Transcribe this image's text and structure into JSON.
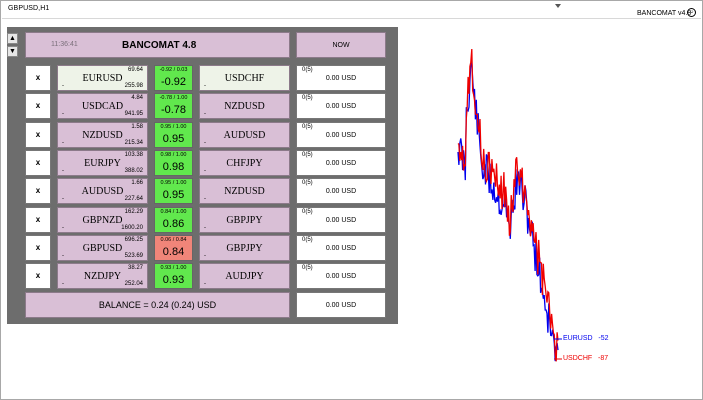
{
  "window": {
    "title": "GBPUSD,H1",
    "ea_label": "BANCOMAT v4.8",
    "smiley": "☺"
  },
  "panel": {
    "header_time": "11:36:41",
    "header_title": "BANCOMAT 4.8",
    "now_label": "NOW",
    "close_label": "x",
    "up_arrow": "▲",
    "down_arrow": "▼",
    "rows": [
      {
        "pair_a": "EURUSD",
        "a_top": "69.64",
        "a_bottom": "255.98",
        "a_dash": "-",
        "mid_small": "-0.92 / 0.03",
        "mid_big": "-0.92",
        "pair_b": "USDCHF",
        "b_dash": "-",
        "right_small": "0(5)",
        "right_val": "0.00 USD"
      },
      {
        "pair_a": "USDCAD",
        "a_top": "4.84",
        "a_bottom": "941.95",
        "a_dash": "-",
        "mid_small": "-0.78 / 1.00",
        "mid_big": "-0.78",
        "pair_b": "NZDUSD",
        "b_dash": "-",
        "right_small": "0(5)",
        "right_val": "0.00 USD"
      },
      {
        "pair_a": "NZDUSD",
        "a_top": "1.58",
        "a_bottom": "215.34",
        "a_dash": "-",
        "mid_small": "0.95 / 1.00",
        "mid_big": "0.95",
        "pair_b": "AUDUSD",
        "b_dash": "-",
        "right_small": "0(5)",
        "right_val": "0.00 USD"
      },
      {
        "pair_a": "EURJPY",
        "a_top": "103.38",
        "a_bottom": "388.02",
        "a_dash": "-",
        "mid_small": "0.98 / 1.00",
        "mid_big": "0.98",
        "pair_b": "CHFJPY",
        "b_dash": "-",
        "right_small": "0(5)",
        "right_val": "0.00 USD"
      },
      {
        "pair_a": "AUDUSD",
        "a_top": "1.66",
        "a_bottom": "227.64",
        "a_dash": "-",
        "mid_small": "0.95 / 1.00",
        "mid_big": "0.95",
        "pair_b": "NZDUSD",
        "b_dash": "-",
        "right_small": "0(5)",
        "right_val": "0.00 USD"
      },
      {
        "pair_a": "GBPNZD",
        "a_top": "162.29",
        "a_bottom": "1600.20",
        "a_dash": "-",
        "mid_small": "0.84 / 1.00",
        "mid_big": "0.86",
        "pair_b": "GBPJPY",
        "b_dash": "-",
        "right_small": "0(5)",
        "right_val": "0.00 USD"
      },
      {
        "pair_a": "GBPUSD",
        "a_top": "696.25",
        "a_bottom": "523.69",
        "a_dash": "-",
        "mid_small": "0.06 / 0.84",
        "mid_big": "0.84",
        "pair_b": "GBPJPY",
        "b_dash": "-",
        "right_small": "0(5)",
        "right_val": "0.00 USD"
      },
      {
        "pair_a": "NZDJPY",
        "a_top": "38.27",
        "a_bottom": "252.04",
        "a_dash": "-",
        "mid_small": "0.93 / 1.00",
        "mid_big": "0.93",
        "pair_b": "AUDJPY",
        "b_dash": "-",
        "right_small": "0(5)",
        "right_val": "0.00 USD"
      }
    ],
    "balance_label": "BALANCE = 0.24 (0.24)  USD",
    "balance_total": "0.00 USD"
  },
  "colors": {
    "green": "#61e84d",
    "red": "#f08579",
    "lilac": "#d9bfd6",
    "panel_bg": "#6d6d6d",
    "line_blue": "#0000ee",
    "line_red": "#ee0000"
  },
  "chart_data": {
    "type": "line",
    "series": [
      {
        "name": "EURUSD",
        "value_label": "-52",
        "color": "#0000ee"
      },
      {
        "name": "USDCHF",
        "value_label": "-87",
        "color": "#ee0000"
      }
    ]
  }
}
